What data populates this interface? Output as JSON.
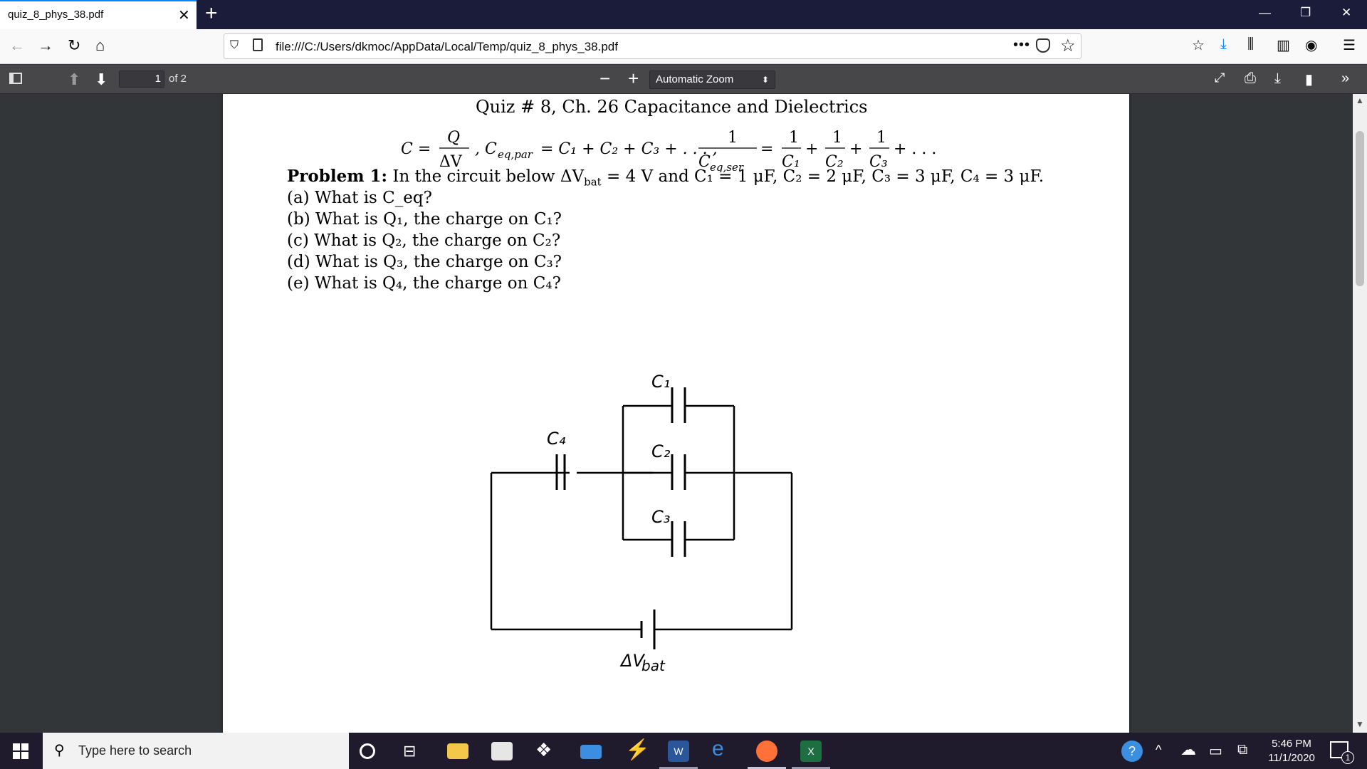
{
  "browser": {
    "tab_title": "quiz_8_phys_38.pdf",
    "url": "file:///C:/Users/dkmoc/AppData/Local/Temp/quiz_8_phys_38.pdf"
  },
  "pdf_toolbar": {
    "page_number": "1",
    "page_count": "of 2",
    "zoom": "Automatic Zoom"
  },
  "document": {
    "title": "Quiz # 8, Ch.  26 Capacitance and Dielectrics",
    "formula": {
      "c_lhs": "C =",
      "q": "Q",
      "dv": "ΔV",
      "par": ", C",
      "par_sub": "eq,par",
      "par_rhs": "= C₁ + C₂ + C₃ + . . . ,",
      "one": "1",
      "ser": "C",
      "ser_sub": "eq,ser",
      "c1": "C₁",
      "c2": "C₂",
      "c3": "C₃",
      "tail": "+ . . ."
    },
    "problem": {
      "label": "Problem 1:",
      "text": "In the circuit below ΔV",
      "bat_sub": "bat",
      "text2": " = 4 V and C₁ = 1 μF, C₂ = 2 μF, C₃ = 3 μF, C₄ = 3 μF."
    },
    "questions": [
      "(a) What is C_eq?",
      "(b) What is Q₁, the charge on C₁?",
      "(c) What is Q₂, the charge on C₂?",
      "(d) What is Q₃, the charge on C₃?",
      "(e) What is Q₄, the charge on C₄?"
    ],
    "circuit_labels": {
      "c1": "C₁",
      "c2": "C₂",
      "c3": "C₃",
      "c4": "C₄",
      "battery": "ΔV",
      "battery_sub": "bat"
    }
  },
  "taskbar": {
    "search_placeholder": "Type here to search",
    "time": "5:46 PM",
    "date": "11/1/2020",
    "notification_count": "1"
  }
}
